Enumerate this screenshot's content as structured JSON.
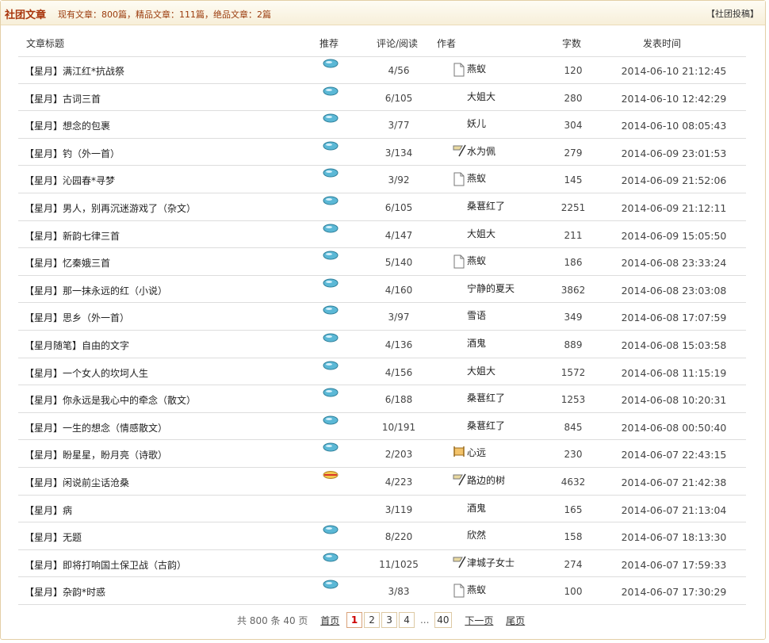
{
  "header": {
    "title": "社团文章",
    "stats": "现有文章：800篇，精品文章：111篇，绝品文章：2篇",
    "submit": "【社团投稿】"
  },
  "columns": {
    "title": "文章标题",
    "recommend": "推荐",
    "comments_reads": "评论/阅读",
    "author": "作者",
    "word_count": "字数",
    "date": "发表时间"
  },
  "rows": [
    {
      "title": "【星月】满江红*抗战祭",
      "rec": "blue",
      "cr": "4/56",
      "author_icon": "page-icon",
      "author": "燕蚁",
      "words": "120",
      "date": "2014-06-10 21:12:45"
    },
    {
      "title": "【星月】古词三首",
      "rec": "blue",
      "cr": "6/105",
      "author_icon": "",
      "author": "大姐大",
      "words": "280",
      "date": "2014-06-10 12:42:29"
    },
    {
      "title": "【星月】想念的包裹",
      "rec": "blue",
      "cr": "3/77",
      "author_icon": "",
      "author": "妖儿",
      "words": "304",
      "date": "2014-06-10 08:05:43"
    },
    {
      "title": "【星月】钓（外一首）",
      "rec": "blue",
      "cr": "3/134",
      "author_icon": "flag-icon",
      "author": "水为佩",
      "words": "279",
      "date": "2014-06-09 23:01:53"
    },
    {
      "title": "【星月】沁园春*寻梦",
      "rec": "blue",
      "cr": "3/92",
      "author_icon": "page-icon",
      "author": "燕蚁",
      "words": "145",
      "date": "2014-06-09 21:52:06"
    },
    {
      "title": "【星月】男人，别再沉迷游戏了（杂文）",
      "rec": "blue",
      "cr": "6/105",
      "author_icon": "",
      "author": "桑葚红了",
      "words": "2251",
      "date": "2014-06-09 21:12:11"
    },
    {
      "title": "【星月】新韵七律三首",
      "rec": "blue",
      "cr": "4/147",
      "author_icon": "",
      "author": "大姐大",
      "words": "211",
      "date": "2014-06-09 15:05:50"
    },
    {
      "title": "【星月】忆秦娥三首",
      "rec": "blue",
      "cr": "5/140",
      "author_icon": "page-icon",
      "author": "燕蚁",
      "words": "186",
      "date": "2014-06-08 23:33:24"
    },
    {
      "title": "【星月】那一抹永远的红（小说）",
      "rec": "blue",
      "cr": "4/160",
      "author_icon": "",
      "author": "宁静的夏天",
      "words": "3862",
      "date": "2014-06-08 23:03:08"
    },
    {
      "title": "【星月】思乡（外一首）",
      "rec": "blue",
      "cr": "3/97",
      "author_icon": "",
      "author": "雪语",
      "words": "349",
      "date": "2014-06-08 17:07:59"
    },
    {
      "title": "【星月随笔】自由的文字",
      "rec": "blue",
      "cr": "4/136",
      "author_icon": "",
      "author": "酒鬼",
      "words": "889",
      "date": "2014-06-08 15:03:58"
    },
    {
      "title": "【星月】一个女人的坎坷人生",
      "rec": "blue",
      "cr": "4/156",
      "author_icon": "",
      "author": "大姐大",
      "words": "1572",
      "date": "2014-06-08 11:15:19"
    },
    {
      "title": "【星月】你永远是我心中的牵念（散文）",
      "rec": "blue",
      "cr": "6/188",
      "author_icon": "",
      "author": "桑葚红了",
      "words": "1253",
      "date": "2014-06-08 10:20:31"
    },
    {
      "title": "【星月】一生的想念（情感散文）",
      "rec": "blue",
      "cr": "10/191",
      "author_icon": "",
      "author": "桑葚红了",
      "words": "845",
      "date": "2014-06-08 00:50:40"
    },
    {
      "title": "【星月】盼星星，盼月亮（诗歌）",
      "rec": "blue",
      "cr": "2/203",
      "author_icon": "banner-icon",
      "author": "心远",
      "words": "230",
      "date": "2014-06-07 22:43:15"
    },
    {
      "title": "【星月】闲说前尘话沧桑",
      "rec": "red",
      "cr": "4/223",
      "author_icon": "flag-icon",
      "author": "路边的树",
      "words": "4632",
      "date": "2014-06-07 21:42:38"
    },
    {
      "title": "【星月】病",
      "rec": "",
      "cr": "3/119",
      "author_icon": "",
      "author": "酒鬼",
      "words": "165",
      "date": "2014-06-07 21:13:04"
    },
    {
      "title": "【星月】无题",
      "rec": "blue",
      "cr": "8/220",
      "author_icon": "",
      "author": "欣然",
      "words": "158",
      "date": "2014-06-07 18:13:30"
    },
    {
      "title": "【星月】即将打响国土保卫战（古韵）",
      "rec": "blue",
      "cr": "11/1025",
      "author_icon": "flag-icon",
      "author": "津城子女士",
      "words": "274",
      "date": "2014-06-07 17:59:33"
    },
    {
      "title": "【星月】杂韵*时惑",
      "rec": "blue",
      "cr": "3/83",
      "author_icon": "page-icon",
      "author": "燕蚁",
      "words": "100",
      "date": "2014-06-07 17:30:29"
    }
  ],
  "pagination": {
    "summary": "共 800 条 40 页",
    "first": "首页",
    "pages": [
      "1",
      "2",
      "3",
      "4"
    ],
    "ellipsis": "...",
    "last_page": "40",
    "next": "下一页",
    "last": "尾页",
    "current": "1"
  },
  "colors": {
    "title": "#a8340b",
    "stats": "#9a3a0b",
    "border": "#e3cfa6",
    "current_page": "#cc0000"
  }
}
